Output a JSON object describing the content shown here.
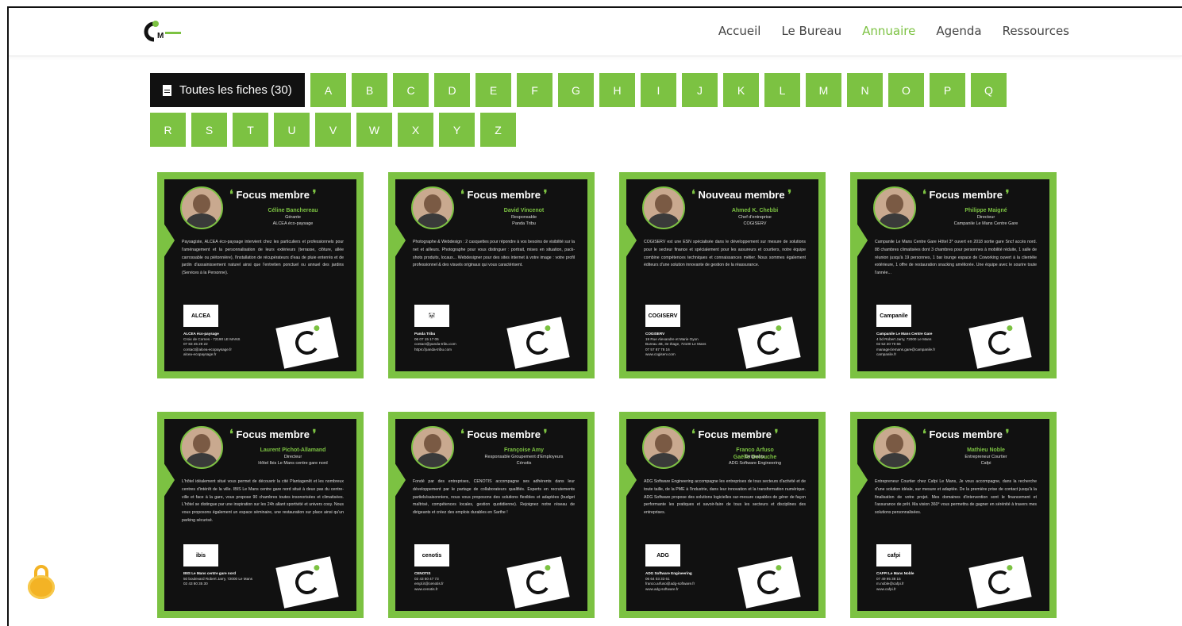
{
  "nav": {
    "items": [
      "Accueil",
      "Le Bureau",
      "Annuaire",
      "Agenda",
      "Ressources"
    ],
    "active": "Annuaire"
  },
  "filters": {
    "all_label": "Toutes les fiches (30)",
    "letters_row1": [
      "A",
      "B",
      "C",
      "D",
      "E",
      "F",
      "G",
      "H",
      "I",
      "J",
      "K",
      "L",
      "M",
      "N",
      "O",
      "P",
      "Q"
    ],
    "letters_row2": [
      "R",
      "S",
      "T",
      "U",
      "V",
      "W",
      "X",
      "Y",
      "Z"
    ]
  },
  "colors": {
    "accent": "#7cc242",
    "dark": "#111111"
  },
  "cards": [
    {
      "title": "Focus membre",
      "name": "Céline Banchereau",
      "role": "Gérante\nALCEA éco-paysage",
      "desc": "Paysagiste, ALCEA éco-paysage intervient chez les particuliers et professionnels pour l'aménagement et la personnalisation de leurs extérieurs (terrasse, clôture, allée carrossable ou piétonnière), l'installation de récupérateurs d'eau de pluie enterrés et de jardin d'assainissement naturel ainsi que l'entretien ponctuel ou annuel des jardins (Services à la Personne).",
      "logo": "ALCEA",
      "contact_name": "ALCEA éco-paysage",
      "contact": "Croix de Cornes - 72190 LE MANS\n07 83 45 29 22\ncontact@alcea-ecopaysage.fr\nalcea-ecopaysage.fr"
    },
    {
      "title": "Focus membre",
      "name": "David Vincenot",
      "role": "Responsable\nPanda Tribu",
      "desc": "Photographe & Webdesign : 2 casquettes pour répondre à vos besoins de visibilité sur la net et ailleurs. Photographe pour vous distinguer : portrait, mises en situation, pack-shots produits, locaux... Webdesigner pour des sites internet à votre image : votre profil professionnel & des visuels originaux qui vous caractérisent.",
      "logo": "🐼",
      "contact_name": "Panda Tribu",
      "contact": "06 07 15 17 05\ncontact@panda-tribu.com\nhttps://panda-tribu.com"
    },
    {
      "title": "Nouveau membre",
      "name": "Ahmed K. Chebbi",
      "role": "Chef d'entreprise\nCOGISERV",
      "desc": "COGISERV est une ESN spécialisée dans le développement sur mesure de solutions pour le secteur finance et spécialement pour les assureurs et courtiers, notre équipe combine compétences techniques et connaissances métier. Nous sommes également éditeurs d'une solution innovante de gestion de la réassurance.",
      "logo": "COGISERV",
      "contact_name": "COGISERV",
      "contact": "19 Rue Alexandre et Marie Oyon\nBureau 4B, 3e étage, 72100 Le Mans\n07 57 87 78 16\nwww.cogiserv.com"
    },
    {
      "title": "Focus membre",
      "name": "Philippe Maigné",
      "role": "Directeur\nCampanile Le Mans Centre Gare",
      "desc": "Campanile Le Mans Centre Gare Hôtel 3* ouvert en 2018 sortie gare Sncf accès nord. 88 chambres climatisées dont 3 chambres pour personnes à mobilité réduite, 1 salle de réunion jusqu'à 19 personnes, 1 bar lounge espace de Coworking ouvert à la clientèle extérieure, 1 offre de restauration snacking améliorée. Une équipe avec le sourire toute l'année...",
      "logo": "Campanile",
      "contact_name": "Campanile Le Mans Centre Gare",
      "contact": "4 bd Robert Jarry, 72000 Le Mans\n02 52 20 70 66\nmanager.lemans.gare@campanile.fr\ncampanile.fr"
    },
    {
      "title": "Focus membre",
      "name": "Laurent Pichot-Allamand",
      "role": "Directeur\nHôtel Ibis Le Mans centre gare nord",
      "desc": "L'hôtel idéalement situé vous permet de découvrir la cité Plantagenêt et les nombreux centres d'intérêt de la ville. IBIS Le Mans centre gare nord situé à deux pas du centre-ville et face à la gare, vous propose 90 chambres toutes insonorisées et climatisées. L'hôtel se distingue par une inspiration sur les 24h allant sportivité et univers cosy. Nous vous proposons également un espace séminaire, une restauration sur place ainsi qu'un parking sécurisé.",
      "logo": "ibis",
      "contact_name": "IBIS Le Mans centre gare nord",
      "contact": "50 boulevard Robert Jarry, 72000 Le Mans\n02 43 80 35 30"
    },
    {
      "title": "Focus membre",
      "name": "Françoise Amy",
      "role": "Responsable Groupement d'Employeurs\nCénotis",
      "desc": "Fondé par des entreprises, CENOTIS accompagne ses adhérents dans leur développement par le partage de collaborateurs qualifiés. Experts en recrutements partiels/saisonniers, nous vous proposons des solutions flexibles et adaptées (budget maîtrisé, compétences locales, gestion quotidienne). Rejoignez notre réseau de dirigeants et créez des emplois durables en Sarthe !",
      "logo": "cenotis",
      "contact_name": "CENOTIS",
      "contact": "02 43 50 47 73\nempl.it@cenotis.fr\nwww.cenotis.fr"
    },
    {
      "title": "Focus membre",
      "name": "Franco Arfuso\nGaëlle Delouche",
      "role": "Dirigeants\nADG Software Engineering",
      "desc": "ADG Software Engineering accompagne les entreprises de tous secteurs d'activité et de toute taille, de la PME à l'industrie, dans leur innovation et la transformation numérique. ADG Software propose des solutions logicielles sur-mesure capables de gérer de façon performante les pratiques et savoir-faire de tous les secteurs et disciplines des entreprises.",
      "logo": "ADG",
      "contact_name": "ADG Software Engineering",
      "contact": "06 64 03 33 61\nfranco.arfuso@adg-software.fr\nwww.adg-software.fr"
    },
    {
      "title": "Focus membre",
      "name": "Mathieu Noble",
      "role": "Entrepreneur Courtier\nCafpi",
      "desc": "Entrepreneur Courtier chez Cafpi Le Mans, Je vous accompagne, dans la recherche d'une solution idéale, sur mesure et adaptée. De la première prise de contact jusqu'à la finalisation de votre projet. Mes domaines d'intervention sont le financement et l'assurance de prêt. Ma vision 360° vous permettra de gagner en sérénité à travers mes solutions personnalisées.",
      "logo": "cafpi",
      "contact_name": "CAFPI Le Mans Noble",
      "contact": "07 49 95 38 15\nm.noble@cafpi.fr\nwww.cafpi.fr"
    }
  ]
}
